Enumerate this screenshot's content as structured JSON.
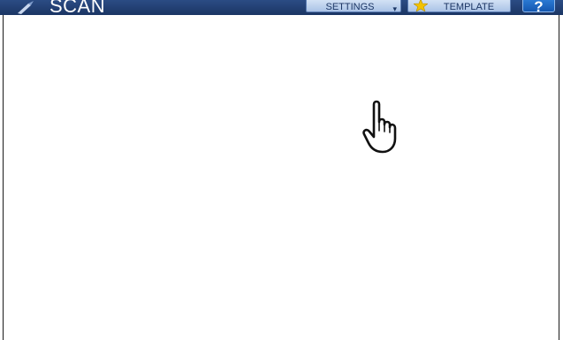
{
  "header": {
    "title": "SCAN",
    "app_icon": "scan-pen-icon",
    "buttons": {
      "settings_label": "SETTINGS",
      "settings_icon": "chevron-down-icon",
      "template_label": "TEMPLATE",
      "template_icon": "star-icon",
      "help_label": "?"
    }
  },
  "content": {
    "cursor_icon": "pointing-hand-icon"
  },
  "colors": {
    "topbar": "#1b3564",
    "button_face": "#c4d6ef",
    "help_button": "#1f6cc8",
    "star": "#f2c200"
  }
}
